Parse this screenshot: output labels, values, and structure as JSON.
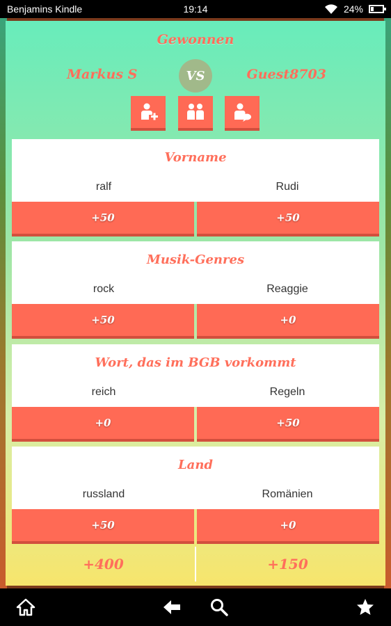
{
  "status_bar": {
    "device_name": "Benjamins Kindle",
    "time": "19:14",
    "battery": "24%",
    "battery_level": 0.24
  },
  "game": {
    "outcome": "Gewonnen",
    "player_left": "Markus S",
    "vs_label": "VS",
    "player_right": "Guest8703",
    "actions": [
      {
        "icon": "add-friend-icon"
      },
      {
        "icon": "rematch-icon"
      },
      {
        "icon": "chat-icon"
      }
    ]
  },
  "categories": [
    {
      "title": "Vorname",
      "answer_left": "ralf",
      "answer_right": "Rudi",
      "score_left": "+50",
      "score_right": "+50"
    },
    {
      "title": "Musik-Genres",
      "answer_left": "rock",
      "answer_right": "Reaggie",
      "score_left": "+50",
      "score_right": "+0"
    },
    {
      "title": "Wort, das im BGB vorkommt",
      "answer_left": "reich",
      "answer_right": "Regeln",
      "score_left": "+0",
      "score_right": "+50"
    },
    {
      "title": "Land",
      "answer_left": "russland",
      "answer_right": "Romänien",
      "score_left": "+50",
      "score_right": "+0"
    }
  ],
  "totals": {
    "left": "+400",
    "right": "+150"
  },
  "nav": {
    "icons": [
      "home-icon",
      "back-icon",
      "search-icon",
      "favorites-icon"
    ]
  },
  "colors": {
    "accent": "#ff6a55",
    "accent_dark": "#d24f3d",
    "panel_top": "#68ecbb",
    "panel_bottom": "#f7e56c"
  }
}
